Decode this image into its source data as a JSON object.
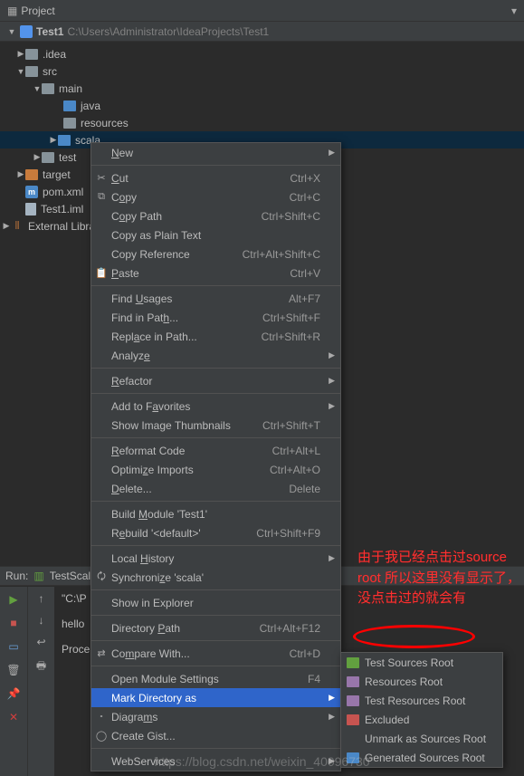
{
  "topbar": {
    "label": "Project"
  },
  "breadcrumb": {
    "project": "Test1",
    "path": "C:\\Users\\Administrator\\IdeaProjects\\Test1"
  },
  "tree": {
    "idea": ".idea",
    "src": "src",
    "main": "main",
    "java": "java",
    "resources": "resources",
    "scala": "scala",
    "test": "test",
    "target": "target",
    "pom": "pom.xml",
    "iml": "Test1.iml",
    "external": "External Libraries"
  },
  "menu": {
    "new": "New",
    "cut": "Cut",
    "cut_k": "Ctrl+X",
    "copy": "Copy",
    "copy_k": "Ctrl+C",
    "copy_path": "Copy Path",
    "copy_path_k": "Ctrl+Shift+C",
    "copy_plain": "Copy as Plain Text",
    "copy_ref": "Copy Reference",
    "copy_ref_k": "Ctrl+Alt+Shift+C",
    "paste": "Paste",
    "paste_k": "Ctrl+V",
    "find_usages": "Find Usages",
    "find_usages_k": "Alt+F7",
    "find_in_path": "Find in Path...",
    "find_in_path_k": "Ctrl+Shift+F",
    "replace_in_path": "Replace in Path...",
    "replace_in_path_k": "Ctrl+Shift+R",
    "analyze": "Analyze",
    "refactor": "Refactor",
    "add_fav": "Add to Favorites",
    "show_thumb": "Show Image Thumbnails",
    "show_thumb_k": "Ctrl+Shift+T",
    "reformat": "Reformat Code",
    "reformat_k": "Ctrl+Alt+L",
    "optimize": "Optimize Imports",
    "optimize_k": "Ctrl+Alt+O",
    "delete": "Delete...",
    "delete_k": "Delete",
    "build": "Build Module 'Test1'",
    "rebuild": "Rebuild '<default>'",
    "rebuild_k": "Ctrl+Shift+F9",
    "local_hist": "Local History",
    "sync": "Synchronize 'scala'",
    "show_explorer": "Show in Explorer",
    "dir_path": "Directory Path",
    "dir_path_k": "Ctrl+Alt+F12",
    "compare": "Compare With...",
    "compare_k": "Ctrl+D",
    "open_module": "Open Module Settings",
    "open_module_k": "F4",
    "mark_dir": "Mark Directory as",
    "diagrams": "Diagrams",
    "create_gist": "Create Gist...",
    "webservices": "WebServices"
  },
  "submenu": {
    "test_sources": "Test Sources Root",
    "resources": "Resources Root",
    "test_resources": "Test Resources Root",
    "excluded": "Excluded",
    "unmark": "Unmark as Sources Root",
    "generated": "Generated Sources Root"
  },
  "annotation": {
    "l1": "由于我已经点击过source",
    "l2": "root 所以这里没有显示了，",
    "l3": "没点击过的就会有"
  },
  "run": {
    "label": "Run:",
    "config": "TestScala"
  },
  "console": {
    "l1": "\"C:\\P",
    "l2": "hello",
    "l3": "Proce"
  },
  "watermark": "https://blog.csdn.net/weixin_40096730"
}
